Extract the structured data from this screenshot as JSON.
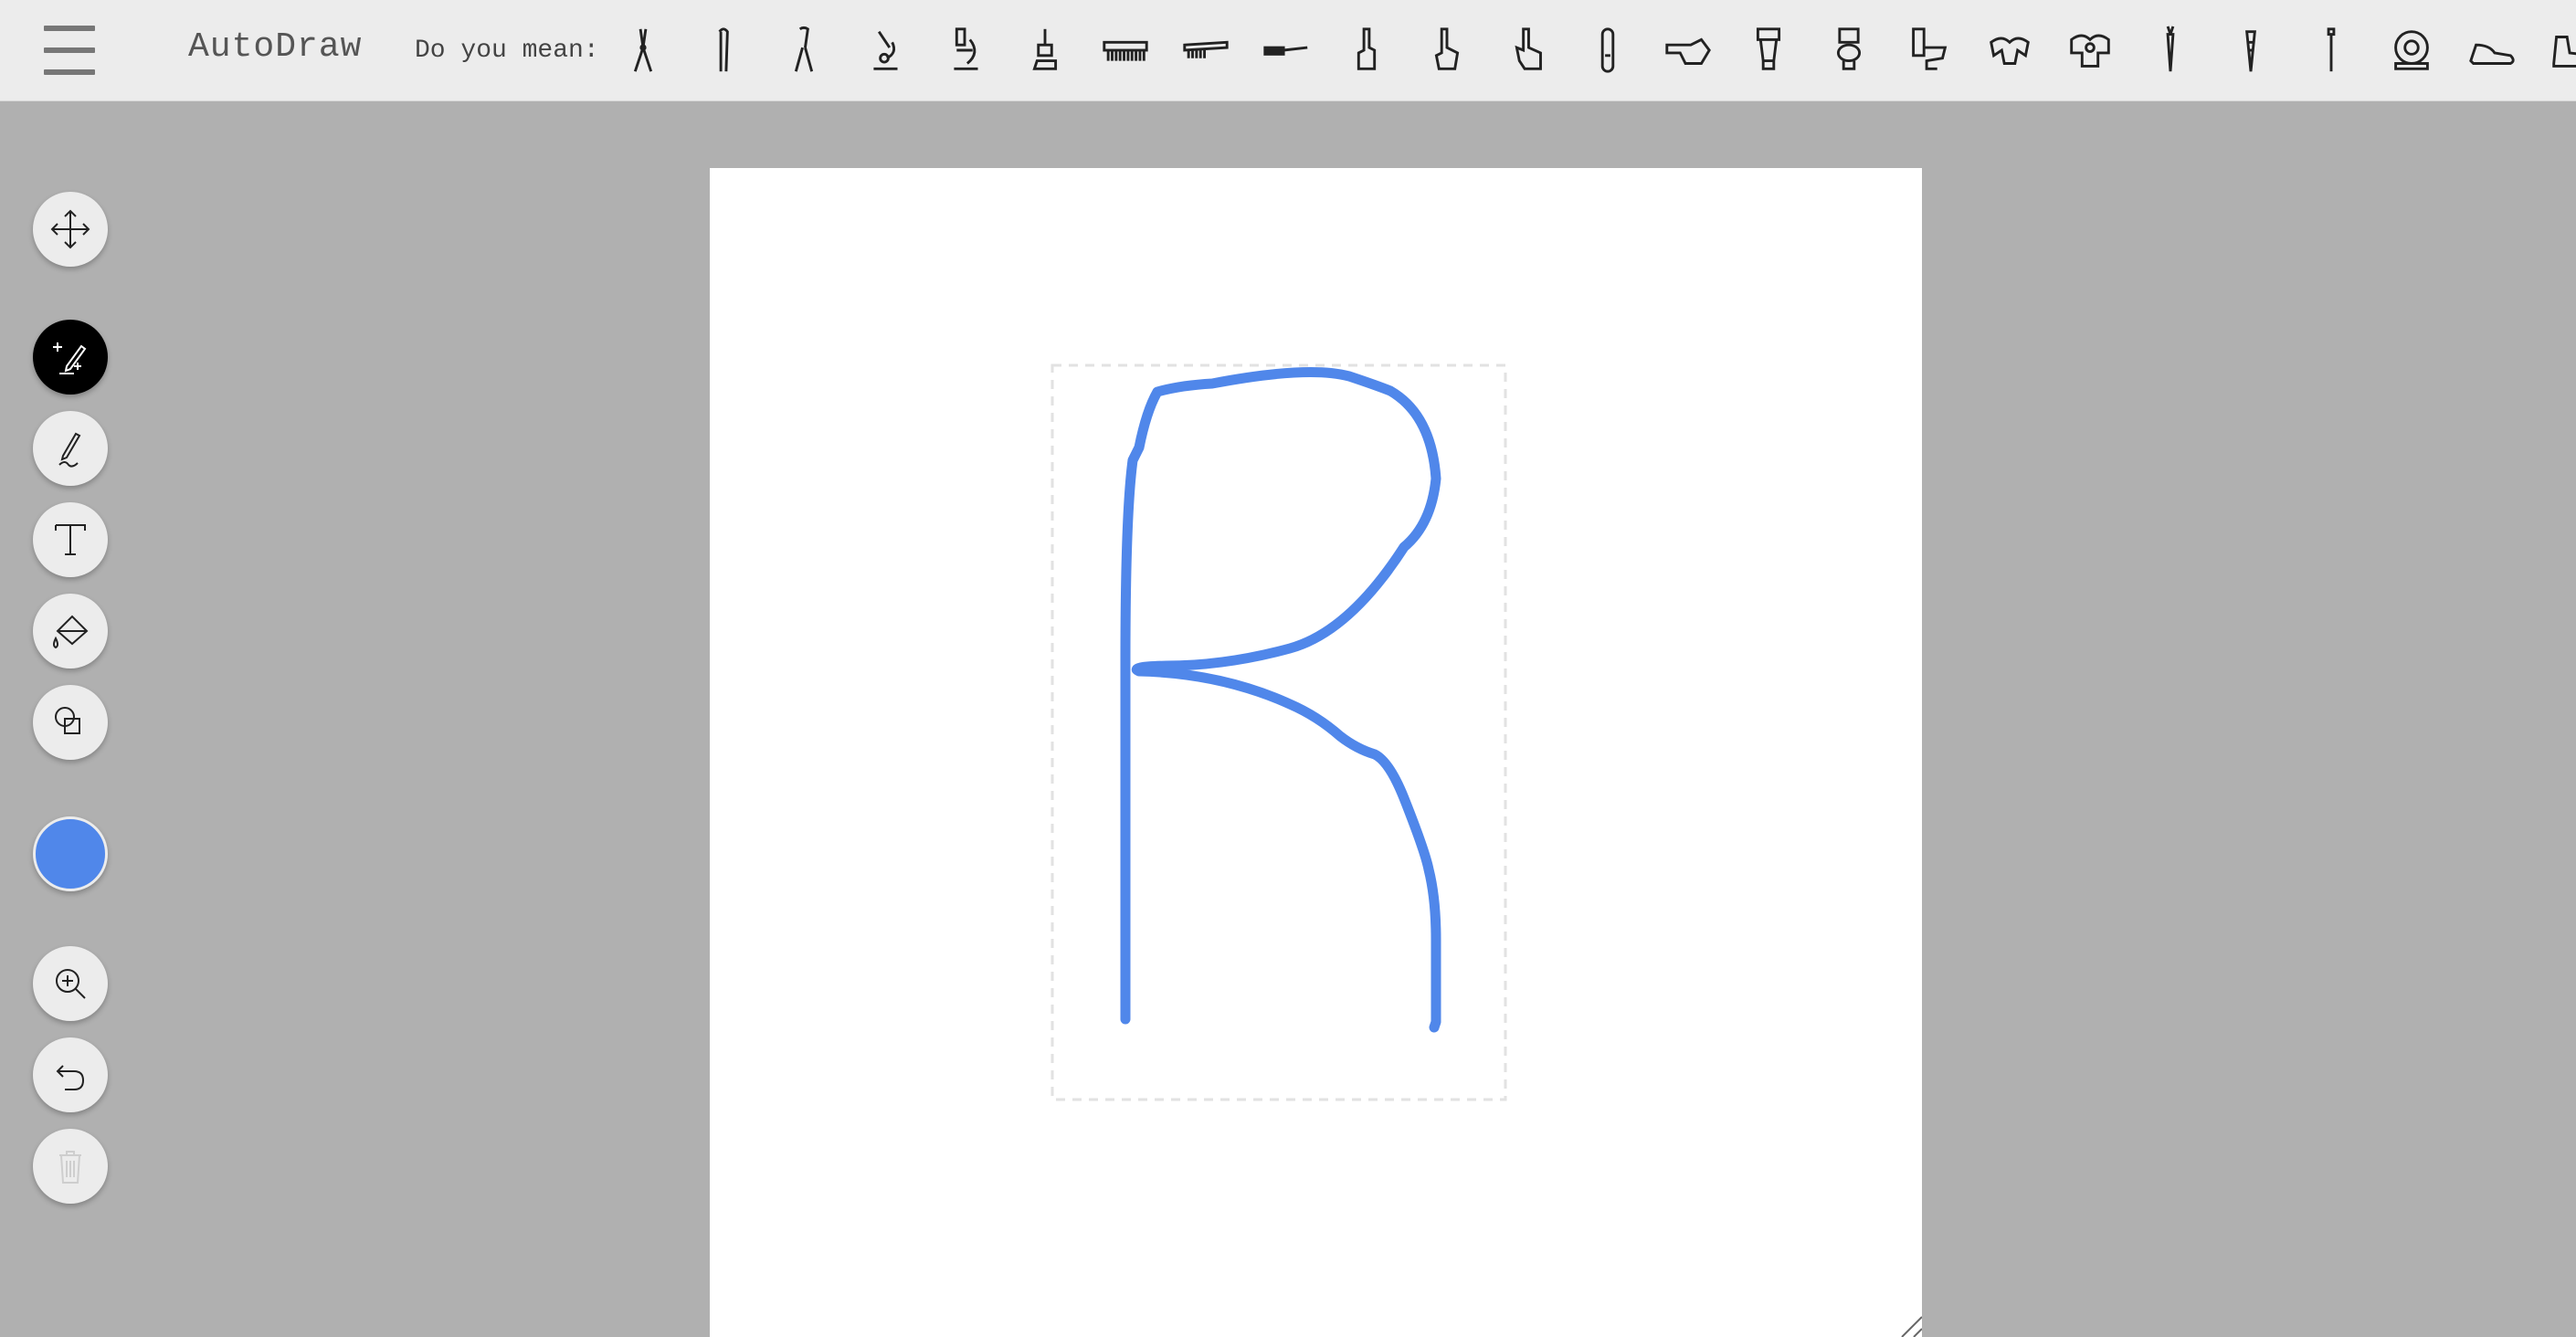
{
  "app": {
    "title": "AutoDraw"
  },
  "suggestions": {
    "label": "Do you mean:",
    "items": [
      "pliers-icon",
      "tweezers-icon",
      "pliers-icon",
      "microscope-icon",
      "microscope-icon",
      "microscope-icon",
      "comb-icon",
      "comb-icon",
      "knife-icon",
      "finger-icon",
      "pointing-hand-icon",
      "pointing-hand-icon",
      "finger-icon",
      "pointing-hand-icon",
      "toilet-icon",
      "toilet-icon",
      "toilet-icon",
      "shoulder-pads-icon",
      "shoulder-pads-icon",
      "carrot-icon",
      "carrot-icon",
      "pin-icon",
      "diving-helmet-icon",
      "shoe-icon",
      "shoe-icon"
    ]
  },
  "tools": {
    "items": [
      "move-icon",
      "autodraw-icon",
      "pencil-icon",
      "text-icon",
      "fill-icon",
      "shape-icon"
    ],
    "active": "autodraw-icon",
    "color": "#5087ea",
    "bottom": [
      "zoom-icon",
      "undo-icon",
      "trash-icon"
    ]
  },
  "drawing": {
    "stroke_color": "#5087ea"
  }
}
